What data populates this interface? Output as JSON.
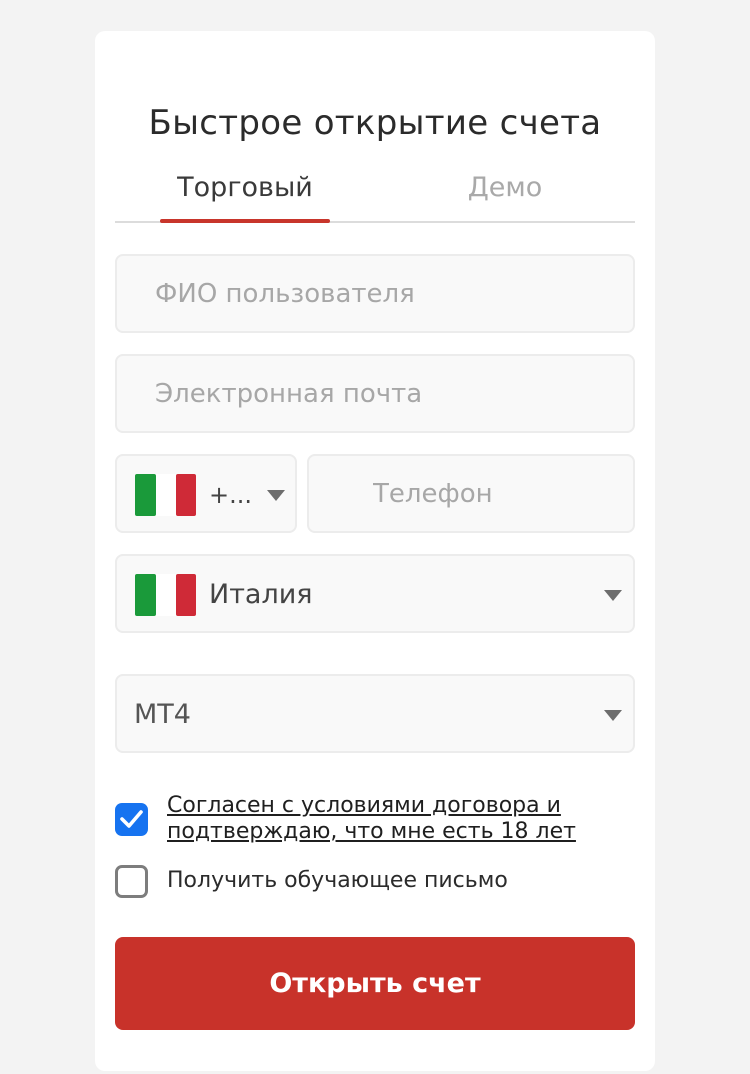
{
  "form": {
    "title": "Быстрое открытие счета",
    "tabs": [
      {
        "label": "Торговый",
        "active": true
      },
      {
        "label": "Демо",
        "active": false
      }
    ],
    "fields": {
      "name_placeholder": "ФИО пользователя",
      "email_placeholder": "Электронная почта",
      "phone_code": "+...",
      "phone_placeholder": "Телефон",
      "country": "Италия",
      "platform": "MT4"
    },
    "checkboxes": {
      "agree_label": "Согласен с условиями договора и подтверждаю, что мне есть 18 лет",
      "agree_checked": true,
      "edu_label": "Получить обучающее письмо",
      "edu_checked": false
    },
    "submit_label": "Открыть счет"
  },
  "colors": {
    "accent": "#c8322a",
    "checkbox": "#1673f0",
    "flag_green": "#1a9a3a",
    "flag_red": "#cf2a37"
  },
  "icons": {
    "flag": "italy-flag-icon",
    "caret": "chevron-down-icon",
    "check": "checkmark-icon"
  }
}
